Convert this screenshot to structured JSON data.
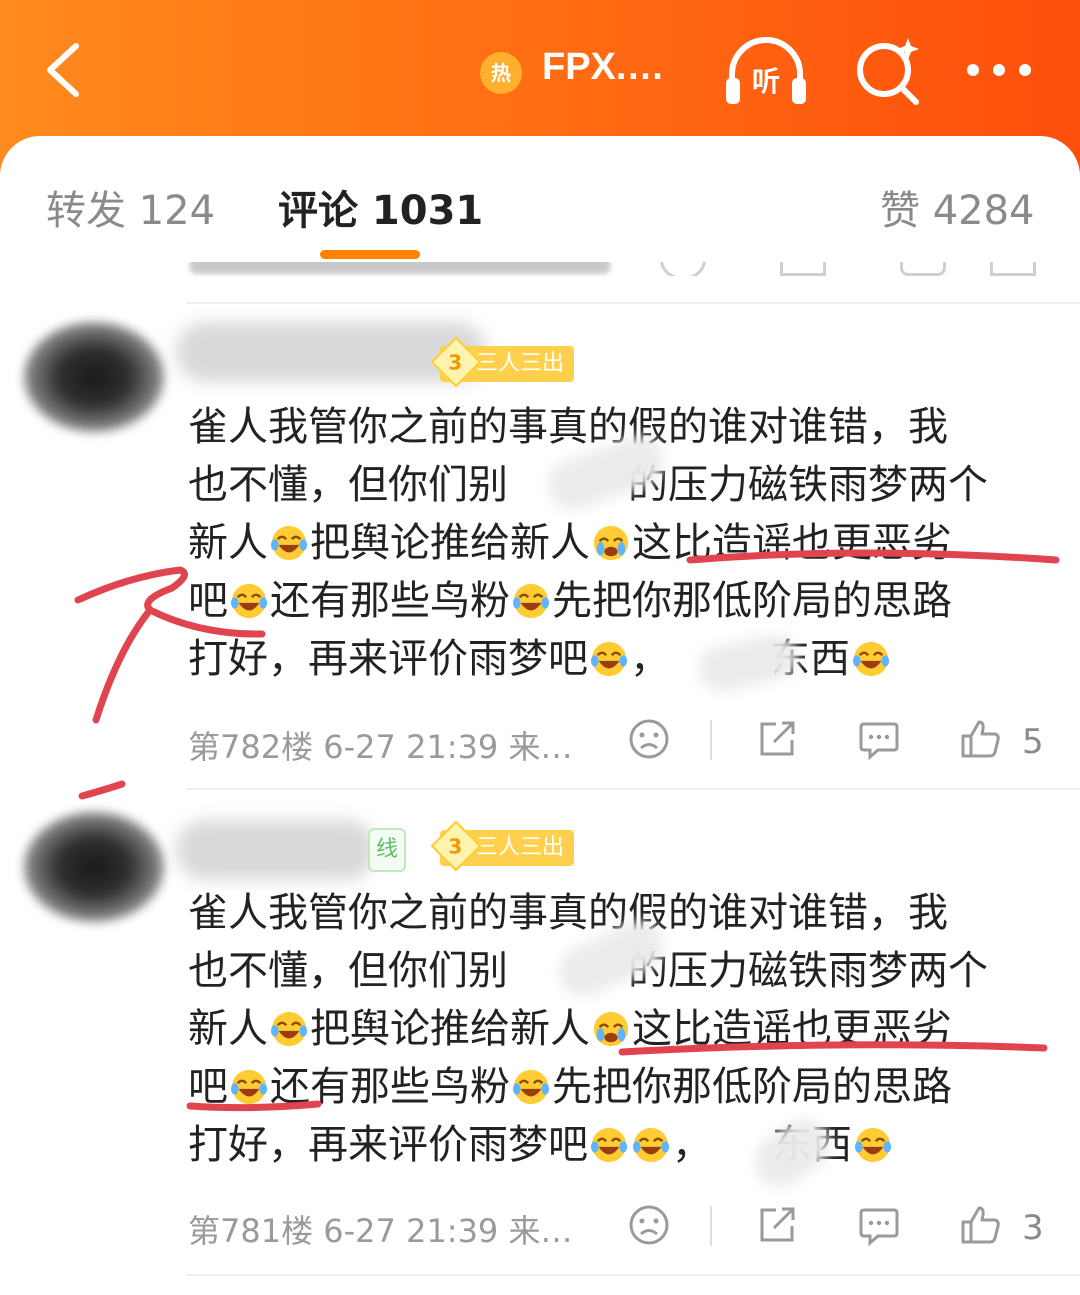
{
  "header": {
    "hot_badge": "热",
    "topic_title": "FPX.…",
    "listen_label": "听",
    "icons": [
      "chevron-left-icon",
      "headphones-icon",
      "search-sparkle-icon",
      "more-dots-icon"
    ],
    "accent_color": "#ff6a12"
  },
  "tabs": [
    {
      "label": "转发 124"
    },
    {
      "label": "评论 1031"
    },
    {
      "label": "赞 4284"
    }
  ],
  "comments": [
    {
      "badge_level": "3",
      "badge_text": "三人三出",
      "lines": [
        "雀人我管你之前的事真的假的谁对谁错，我",
        "也不懂，但你们别",
        "的压力磁铁雨梦两个",
        "新人",
        "把舆论推给新人",
        "这比造谣也更恶劣",
        "吧",
        "还有那些鸟粉",
        "先把你那低阶局的思路",
        "打好，再来评价雨梦吧",
        "，",
        "东西"
      ],
      "floor": "第782楼",
      "time": "6-27 21:39",
      "source": "来…",
      "like_count": "5"
    },
    {
      "online_text": "线",
      "badge_level": "3",
      "badge_text": "三人三出",
      "lines": [
        "雀人我管你之前的事真的假的谁对谁错，我",
        "也不懂，但你们别",
        "的压力磁铁雨梦两个",
        "新人",
        "把舆论推给新人",
        "这比造谣也更恶劣",
        "吧",
        "还有那些鸟粉",
        "先把你那低阶局的思路",
        "打好，再来评价雨梦吧",
        "，",
        "东西"
      ],
      "floor": "第781楼",
      "time": "6-27 21:39",
      "source": "来…",
      "like_count": "3"
    }
  ]
}
